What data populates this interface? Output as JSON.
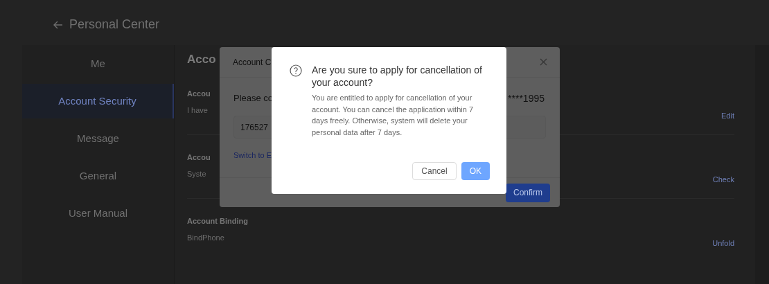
{
  "header": {
    "title": "Personal Center"
  },
  "sidebar": {
    "items": [
      {
        "label": "Me",
        "selected": false
      },
      {
        "label": "Account Security",
        "selected": true
      },
      {
        "label": "Message",
        "selected": false
      },
      {
        "label": "General",
        "selected": false
      },
      {
        "label": "User Manual",
        "selected": false
      }
    ]
  },
  "content": {
    "heading": "Acco",
    "rows": [
      {
        "label": "Accou",
        "description": "I have",
        "action": "Edit"
      },
      {
        "label": "Accou",
        "description": "Syste",
        "action": "Check"
      },
      {
        "label": "Account Binding",
        "description": "BindPhone",
        "action": "Unfold"
      }
    ]
  },
  "dialog": {
    "title": "Account C",
    "prompt": "Please co",
    "masked_phone": "****1995",
    "code_value": "176527",
    "switch_link": "Switch to E",
    "confirm_button": "Confirm"
  },
  "confirm_dialog": {
    "title": "Are you sure to apply for cancellation of your account?",
    "message": "You are entitled to apply for cancellation of your account. You can cancel the application within 7 days freely. Otherwise, system will delete your personal data after 7 days.",
    "buttons": [
      {
        "label": "Cancel",
        "kind": "secondary"
      },
      {
        "label": "OK",
        "kind": "primary"
      }
    ]
  }
}
